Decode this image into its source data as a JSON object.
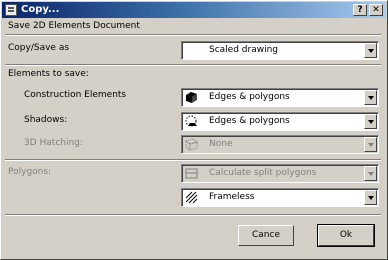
{
  "window": {
    "title": "Copy...",
    "help_label": "?",
    "close_label": "✕"
  },
  "header": "Save 2D Elements Document",
  "copy_save_as": {
    "label": "Copy/Save as",
    "value": "Scaled drawing"
  },
  "elements_section": "Elements to save:",
  "construction": {
    "label": "Construction Elements",
    "value": "Edges & polygons"
  },
  "shadows": {
    "label": "Shadows:",
    "value": "Edges & polygons"
  },
  "hatching": {
    "label": "3D Hatching:",
    "value": "None"
  },
  "polygons": {
    "label": "Polygons:",
    "option1": "Calculate split polygons",
    "option2": "Frameless"
  },
  "buttons": {
    "cancel": "Cance",
    "ok": "Ok"
  }
}
